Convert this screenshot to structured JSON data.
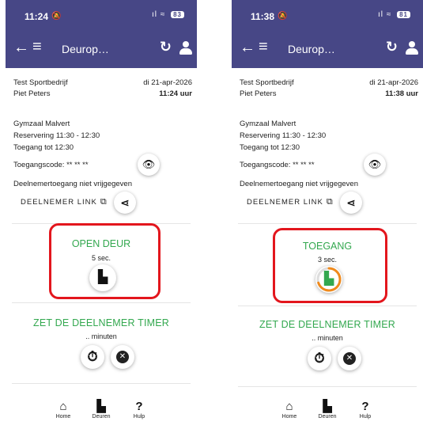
{
  "left": {
    "status": {
      "time": "11:24",
      "bell": "🔕",
      "signal": "ıl",
      "wifi": "≈",
      "battery": "83"
    },
    "appbar": {
      "title": "Deurop…"
    },
    "org": "Test Sportbedrijf",
    "date": "di 21-apr-2026",
    "person": "Piet Peters",
    "current_time": "11:24 uur",
    "location": "Gymzaal Malvert",
    "reservation": "Reservering 11:30 - 12:30",
    "access_until": "Toegang tot 12:30",
    "access_code": "Toegangscode: ** ** **",
    "participant_access": "Deelnemertoegang niet vrijgegeven",
    "participant_link": "DEELNEMER LINK",
    "door": {
      "title": "OPEN DEUR",
      "sub": "5 sec."
    },
    "timer": {
      "title": "ZET DE DEELNEMER TIMER",
      "sub": ".. minuten"
    },
    "nav": {
      "home": "Home",
      "doors": "Deuren",
      "help": "Hulp",
      "help_glyph": "?"
    }
  },
  "right": {
    "status": {
      "time": "11:38",
      "bell": "🔕",
      "signal": "ıl",
      "wifi": "≈",
      "battery": "81"
    },
    "appbar": {
      "title": "Deurop…"
    },
    "org": "Test Sportbedrijf",
    "date": "di 21-apr-2026",
    "person": "Piet Peters",
    "current_time": "11:38 uur",
    "location": "Gymzaal Malvert",
    "reservation": "Reservering 11:30 - 12:30",
    "access_until": "Toegang tot 12:30",
    "access_code": "Toegangscode: ** ** **",
    "participant_access": "Deelnemertoegang niet vrijgegeven",
    "participant_link": "DEELNEMER LINK",
    "door": {
      "title": "TOEGANG",
      "sub": "3 sec."
    },
    "timer": {
      "title": "ZET DE DEELNEMER TIMER",
      "sub": ".. minuten"
    },
    "nav": {
      "home": "Home",
      "doors": "Deuren",
      "help": "Hulp",
      "help_glyph": "?"
    }
  },
  "colors": {
    "appbar": "#474786",
    "accent_green": "#33a84f",
    "highlight_red": "#e3161d",
    "progress_orange": "#f08a1c"
  },
  "icons": [
    "back-arrow-icon",
    "hamburger-menu-icon",
    "refresh-icon",
    "user-icon",
    "eye-icon",
    "external-link-icon",
    "share-icon",
    "door-icon",
    "stopwatch-icon",
    "close-icon",
    "home-icon",
    "doors-icon",
    "help-icon"
  ]
}
